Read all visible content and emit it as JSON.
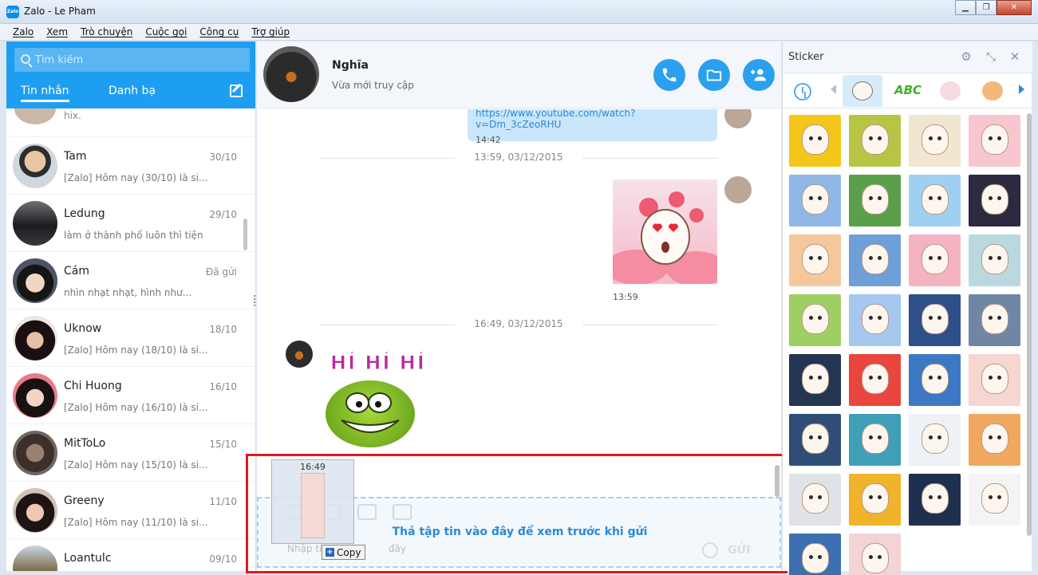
{
  "window": {
    "title": "Zalo - Le Pham",
    "logo_text": "Zalo"
  },
  "menu": [
    "Zalo",
    "Xem",
    "Trò chuyện",
    "Cuộc gọi",
    "Công cụ",
    "Trợ giúp"
  ],
  "sidebar": {
    "search_placeholder": "Tìm kiếm",
    "tabs": {
      "messages": "Tin nhắn",
      "contacts": "Danh bạ"
    },
    "top_preview": "hix.",
    "conversations": [
      {
        "name": "Tam",
        "time": "30/10",
        "preview": "[Zalo] Hôm nay (30/10) là si..."
      },
      {
        "name": "Ledung",
        "time": "29/10",
        "preview": "làm ở thành phố luôn thì tiện"
      },
      {
        "name": "Cám",
        "time": "Đã gửi",
        "preview": "nhìn nhạt nhạt, hình như..."
      },
      {
        "name": "Uknow",
        "time": "18/10",
        "preview": "[Zalo] Hôm nay (18/10) là si..."
      },
      {
        "name": "Chi Huong",
        "time": "16/10",
        "preview": "[Zalo] Hôm nay (16/10) là si..."
      },
      {
        "name": "MitToLo",
        "time": "15/10",
        "preview": "[Zalo] Hôm nay (15/10) là si..."
      },
      {
        "name": "Greeny",
        "time": "11/10",
        "preview": "[Zalo] Hôm nay (11/10) là si..."
      },
      {
        "name": "Loantulc",
        "time": "09/10",
        "preview": ""
      }
    ]
  },
  "chat": {
    "contact_name": "Nghĩa",
    "contact_status": "Vừa mới truy cập",
    "messages": {
      "link": "https://www.youtube.com/watch?v=Dm_3cZeoRHU",
      "link_time": "14:42",
      "divider_1": "13:59, 03/12/2015",
      "sticker_time": "13:59",
      "divider_2": "16:49, 03/12/2015",
      "sticker_text": "HÍ HÍ HÍ"
    },
    "drop_zone_text": "Thả tập tin vào đây để xem trước khi gửi",
    "drag_time": "16:49",
    "copy_label": "Copy",
    "input_placeholder_fragment": "Nhập tin",
    "input_placeholder_tail": "đây",
    "send_label": "GỬI"
  },
  "sticker_panel": {
    "title": "Sticker",
    "abc_tab": "ABC"
  },
  "colors": {
    "accent": "#1e9ef0",
    "highlight_box": "#e0191d",
    "link_bubble": "#c9e6fb",
    "drop_text": "#2a8ad6"
  }
}
